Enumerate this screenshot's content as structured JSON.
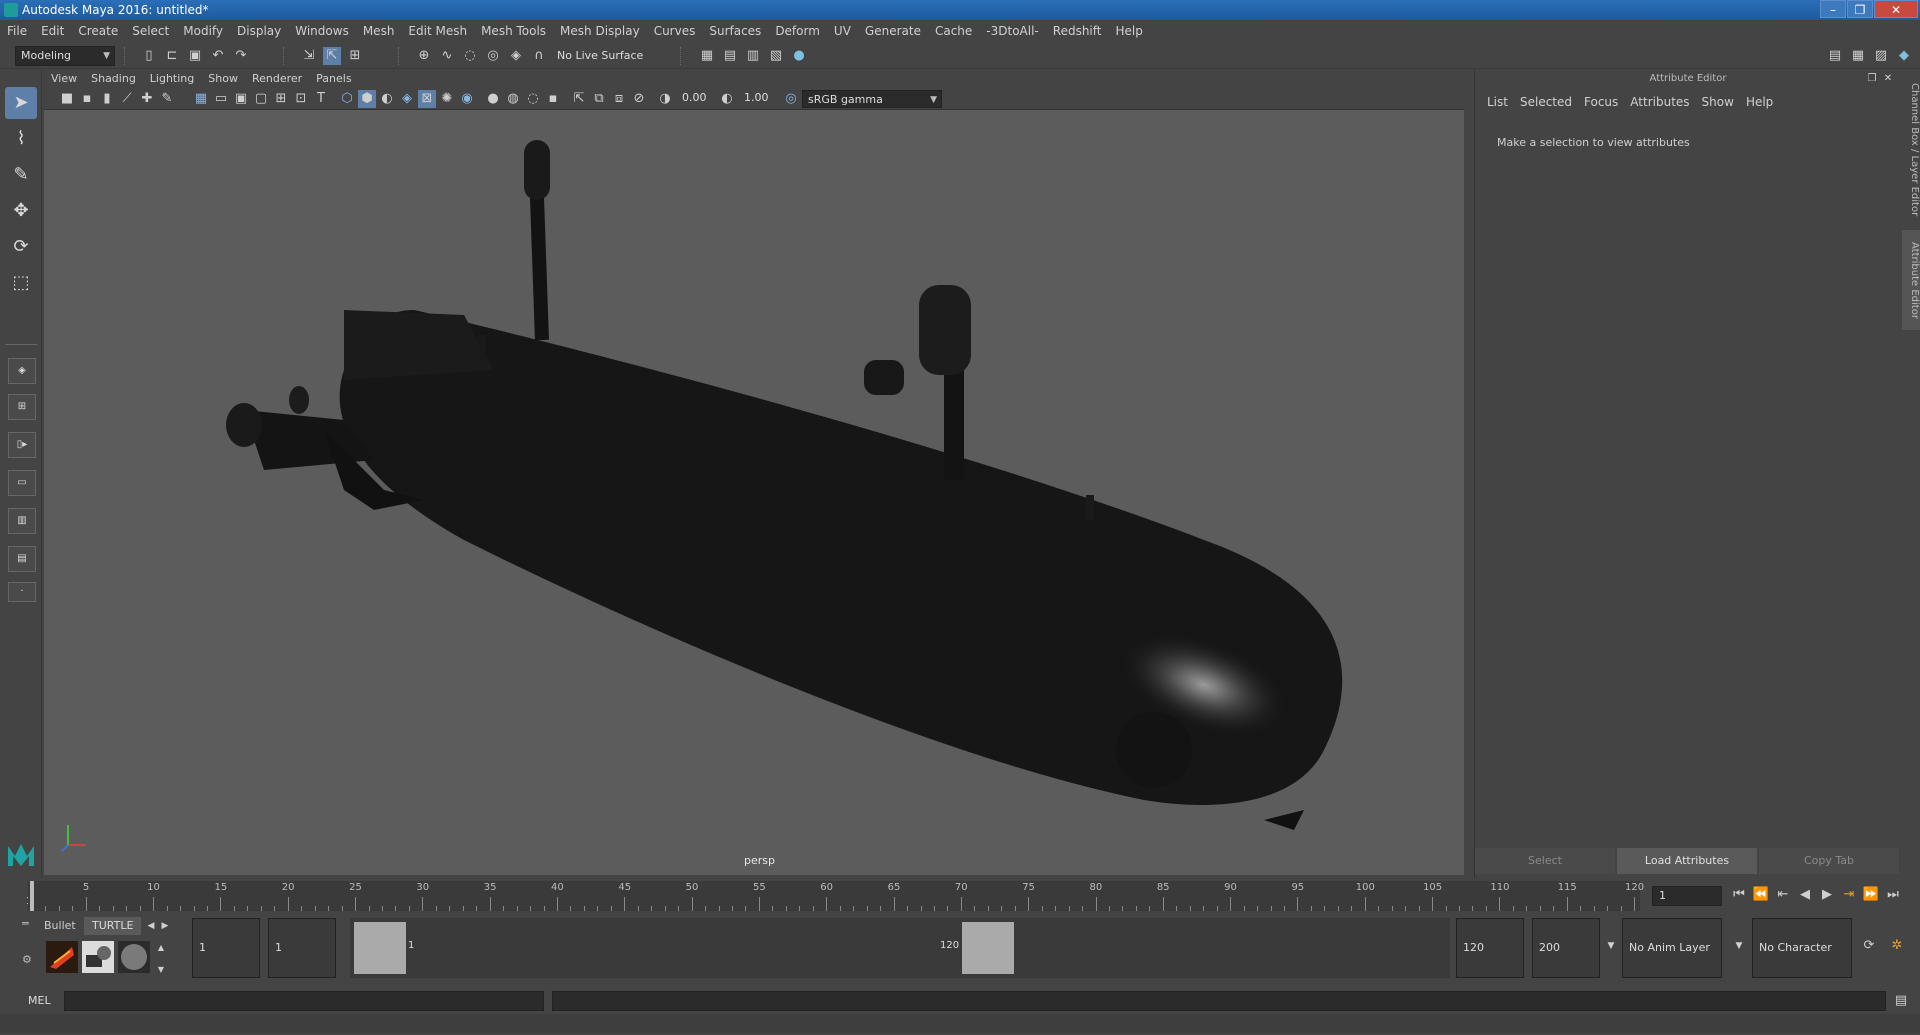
{
  "window": {
    "title": "Autodesk Maya 2016: untitled*",
    "minimize": "–",
    "maximize": "❐",
    "close": "✕"
  },
  "menubar": [
    "File",
    "Edit",
    "Create",
    "Select",
    "Modify",
    "Display",
    "Windows",
    "Mesh",
    "Edit Mesh",
    "Mesh Tools",
    "Mesh Display",
    "Curves",
    "Surfaces",
    "Deform",
    "UV",
    "Generate",
    "Cache",
    "-3DtoAll-",
    "Redshift",
    "Help"
  ],
  "statusline": {
    "menuset": "Modeling",
    "live_surface": "No Live Surface"
  },
  "panel": {
    "menus": [
      "View",
      "Shading",
      "Lighting",
      "Show",
      "Renderer",
      "Panels"
    ],
    "exposure": "0.00",
    "gamma": "1.00",
    "colorspace": "sRGB gamma",
    "camera": "persp"
  },
  "attribute_editor": {
    "header": "Attribute Editor",
    "menus": [
      "List",
      "Selected",
      "Focus",
      "Attributes",
      "Show",
      "Help"
    ],
    "message": "Make a selection to view attributes",
    "buttons": {
      "select": "Select",
      "load": "Load Attributes",
      "copy": "Copy Tab"
    }
  },
  "side_tabs": {
    "channel_box": "Channel Box / Layer Editor",
    "attribute_editor": "Attribute Editor"
  },
  "timeline": {
    "ticks": [
      "5",
      "10",
      "15",
      "20",
      "25",
      "30",
      "35",
      "40",
      "45",
      "50",
      "55",
      "60",
      "65",
      "70",
      "75",
      "80",
      "85",
      "90",
      "95",
      "100",
      "105",
      "110",
      "115",
      "120"
    ],
    "start_label": "1",
    "current_frame": "1"
  },
  "range": {
    "shelf_tabs": [
      "Bullet",
      "TURTLE"
    ],
    "start_field": "1",
    "playback_start": "1",
    "range_start_label": "1",
    "range_end_label": "120",
    "playback_end": "120",
    "end_field": "200",
    "anim_layer": "No Anim Layer",
    "character_set": "No Character Set"
  },
  "command": {
    "lang": "MEL"
  },
  "colors": {
    "viewport_bg": "#5c5c5c",
    "ui_bg": "#444444",
    "accent": "#5d7fa8"
  }
}
